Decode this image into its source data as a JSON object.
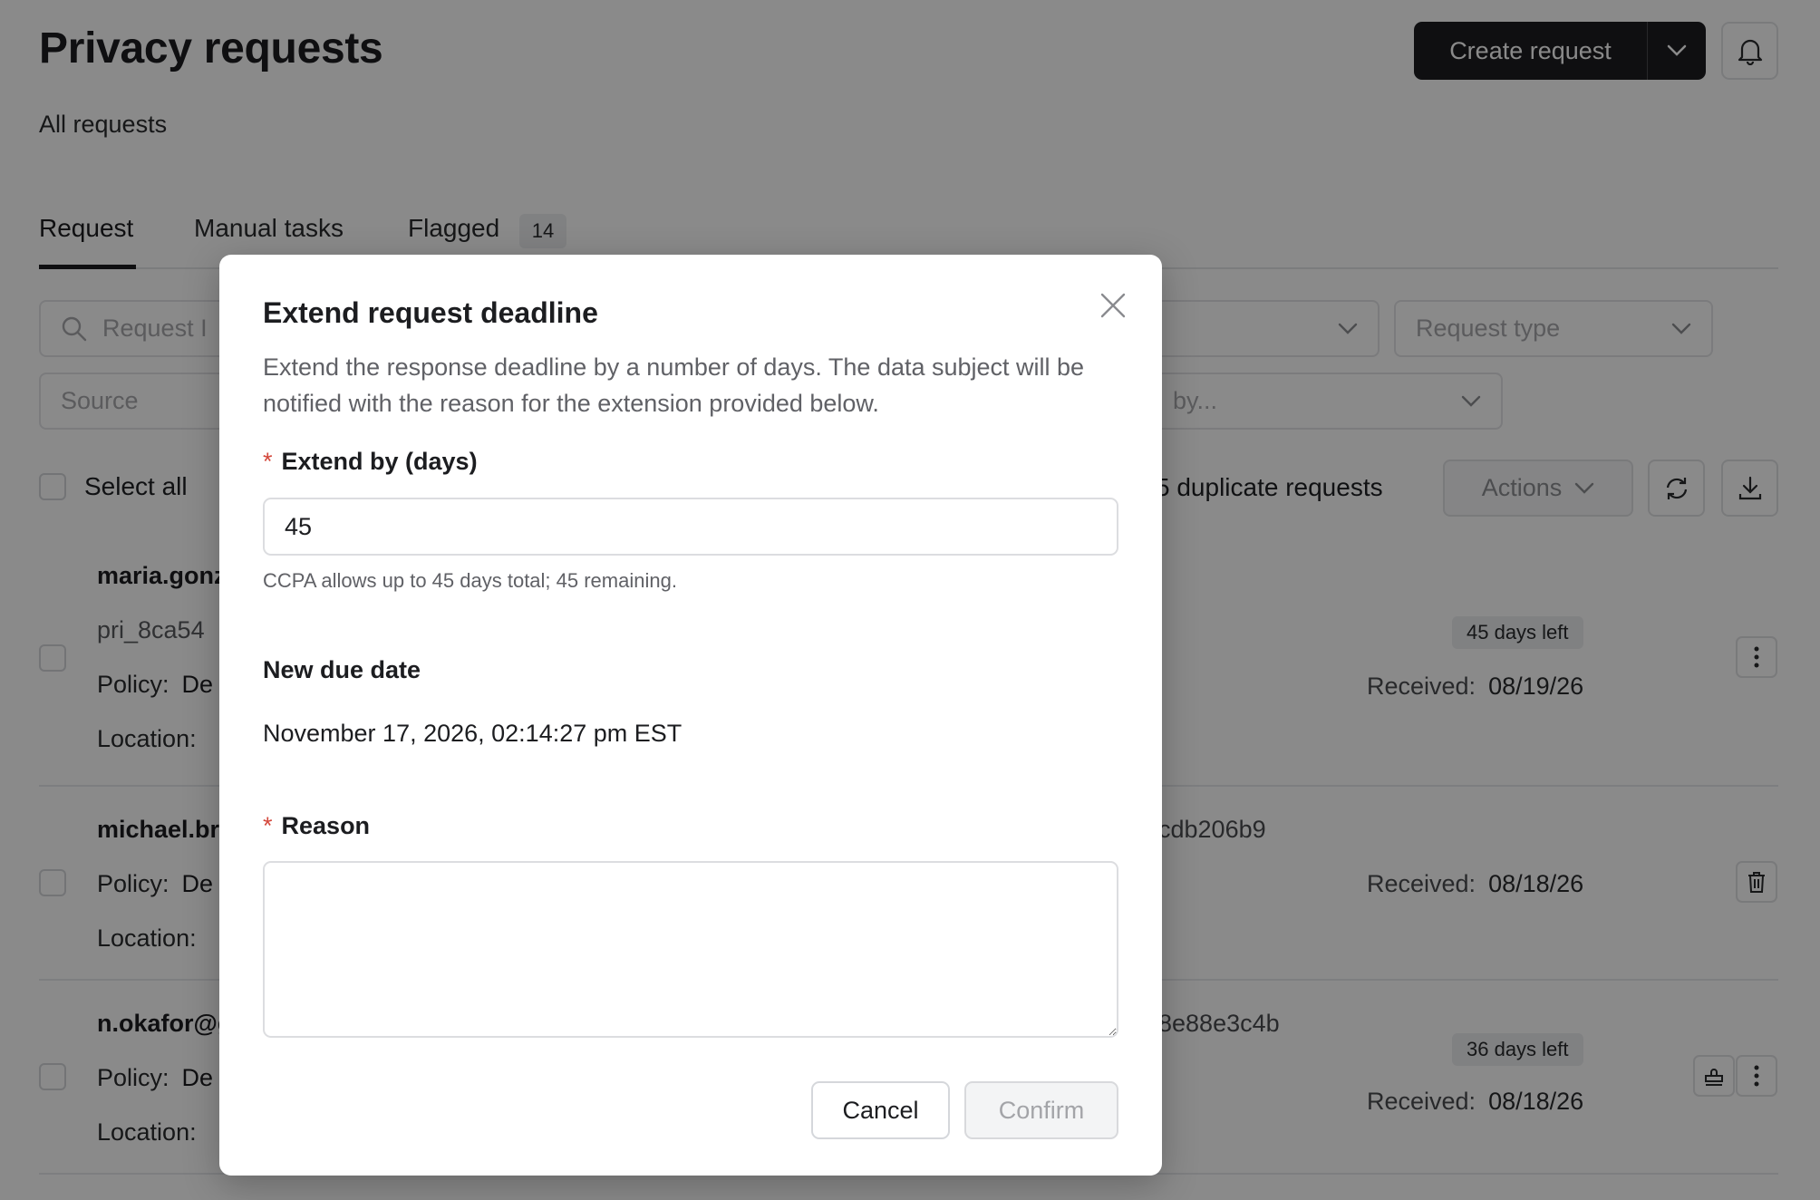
{
  "header": {
    "title": "Privacy requests",
    "subtitle": "All requests",
    "create_label": "Create request"
  },
  "tabs": [
    {
      "label": "Request",
      "active": true
    },
    {
      "label": "Manual tasks",
      "active": false
    },
    {
      "label": "Flagged",
      "active": false,
      "count": "14"
    }
  ],
  "filters": {
    "search_placeholder": "Request I",
    "request_type_placeholder": "Request type",
    "source_placeholder": "Source",
    "sort_placeholder": "by..."
  },
  "toolbar": {
    "select_all_label": "Select all",
    "duplicates_text": "5 duplicate requests",
    "actions_label": "Actions"
  },
  "rows": [
    {
      "email": "maria.gonz",
      "request_id": "pri_8ca54",
      "policy_label": "Policy:",
      "policy_value": "De",
      "location_label": "Location:",
      "days_left": "45 days left",
      "received_label": "Received:",
      "received_value": "08/19/26"
    },
    {
      "email": "michael.br",
      "id_suffix": "cdb206b9",
      "policy_label": "Policy:",
      "policy_value": "De",
      "location_label": "Location:",
      "received_label": "Received:",
      "received_value": "08/18/26"
    },
    {
      "email": "n.okafor@g",
      "id_suffix": "8e88e3c4b",
      "policy_label": "Policy:",
      "policy_value": "De",
      "location_label": "Location:",
      "days_left": "36 days left",
      "received_label": "Received:",
      "received_value": "08/18/26"
    }
  ],
  "modal": {
    "title": "Extend request deadline",
    "description": "Extend the response deadline by a number of days. The data subject will be notified with the reason for the extension provided below.",
    "required_marker": "*",
    "extend_label": "Extend by (days)",
    "extend_value": "45",
    "helper_text": "CCPA allows up to 45 days total; 45 remaining.",
    "due_label": "New due date",
    "due_value": "November 17, 2026, 02:14:27 pm EST",
    "reason_label": "Reason",
    "reason_value": "",
    "cancel_label": "Cancel",
    "confirm_label": "Confirm"
  },
  "colors": {
    "primary_dark": "#1c1d20",
    "required_red": "#d4483c",
    "overlay": "rgba(0,0,0,0.46)"
  },
  "icons": [
    "chevron-down-icon",
    "bell-icon",
    "search-icon",
    "refresh-icon",
    "download-icon",
    "kebab-icon",
    "trash-icon",
    "stamp-icon",
    "close-icon"
  ]
}
